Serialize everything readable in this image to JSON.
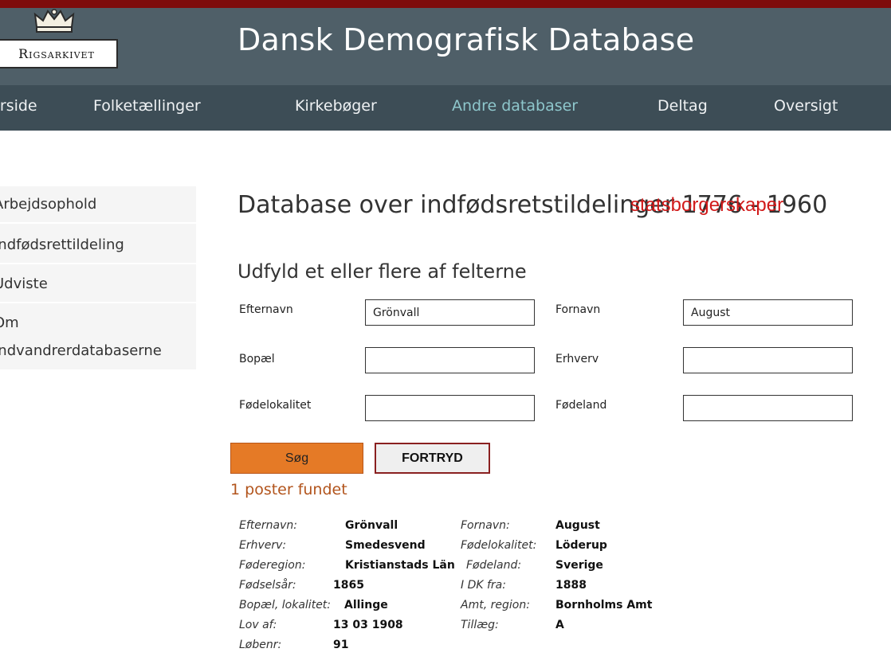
{
  "header": {
    "logo_text": "Rigsarkivet",
    "site_title": "Dansk Demografisk Database"
  },
  "nav": [
    {
      "label": "Forside",
      "active": false
    },
    {
      "label": "Folketællinger",
      "active": false
    },
    {
      "label": "Kirkebøger",
      "active": false
    },
    {
      "label": "Andre databaser",
      "active": true
    },
    {
      "label": "Deltag",
      "active": false
    },
    {
      "label": "Oversigt",
      "active": false
    }
  ],
  "sidebar": {
    "items": [
      {
        "label": "Arbejdsophold"
      },
      {
        "label": "Indfødsrettildeling"
      },
      {
        "label": "Udviste"
      },
      {
        "label": "Om",
        "label2": "Indvandrerdatabaserne"
      }
    ]
  },
  "main": {
    "title": "Database over indfødsretstildelinger 1776 - 1960",
    "annotation": "statsborgerskaper",
    "form_heading": "Udfyld et eller flere af felterne"
  },
  "form": {
    "efternavn": {
      "label": "Efternavn",
      "value": "Grönvall"
    },
    "fornavn": {
      "label": "Fornavn",
      "value": "August"
    },
    "bopael": {
      "label": "Bopæl",
      "value": ""
    },
    "erhverv": {
      "label": "Erhverv",
      "value": ""
    },
    "fodelokalitet": {
      "label": "Fødelokalitet",
      "value": ""
    },
    "fodeland": {
      "label": "Fødeland",
      "value": ""
    },
    "search_button": "Søg",
    "reset_button": "FORTRYD"
  },
  "results": {
    "count_text": "1 poster fundet",
    "record": {
      "efternavn": {
        "label": "Efternavn:",
        "value": "Grönvall"
      },
      "fornavn": {
        "label": "Fornavn:",
        "value": "August"
      },
      "erhverv": {
        "label": "Erhverv:",
        "value": "Smedesvend"
      },
      "fodelokalitet": {
        "label": "Fødelokalitet:",
        "value": "Löderup"
      },
      "foderegion": {
        "label": "Føderegion:",
        "value": "Kristianstads Län"
      },
      "fodeland": {
        "label": "Fødeland:",
        "value": "Sverige"
      },
      "fodselsar": {
        "label": "Fødselsår:",
        "value": "1865"
      },
      "i_dk_fra": {
        "label": "I DK fra:",
        "value": "1888"
      },
      "bopael": {
        "label": "Bopæl, lokalitet:",
        "value": "Allinge"
      },
      "amt": {
        "label": "Amt, region:",
        "value": "Bornholms Amt"
      },
      "lov_af": {
        "label": "Lov af:",
        "value": "13 03 1908"
      },
      "tillaeg": {
        "label": "Tillæg:",
        "value": "A"
      },
      "lobenr": {
        "label": "Løbenr:",
        "value": "91"
      }
    }
  },
  "colors": {
    "top_strip": "#7e0c0c",
    "header_bg": "#4f5f68",
    "nav_bg": "#3d4d56",
    "nav_active": "#8ec7cc",
    "search_button": "#e57a26",
    "result_count": "#b2541c",
    "annotation": "#d11a1a"
  }
}
